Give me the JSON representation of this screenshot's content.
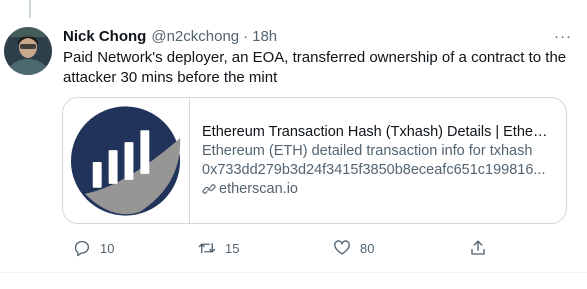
{
  "tweet": {
    "author_name": "Nick Chong",
    "handle": "@n2ckchong",
    "separator": "·",
    "time": "18h",
    "more_label": "···",
    "text": "Paid Network's deployer, an EOA, transferred ownership of a contract to the attacker 30 mins before the mint"
  },
  "card": {
    "title": "Ethereum Transaction Hash (Txhash) Details | Ethers...",
    "description": "Ethereum (ETH) detailed transaction info for txhash",
    "hash": "0x733dd279b3d24f3415f3850b8eceafc651c199816...",
    "domain": "etherscan.io",
    "thumbnail_icon": "etherscan-logo",
    "thumbnail_colors": {
      "navy": "#21325b",
      "gray": "#979695"
    }
  },
  "actions": {
    "reply_count": "10",
    "retweet_count": "15",
    "like_count": "80"
  },
  "colors": {
    "text": "#0f1419",
    "secondary": "#536471",
    "border": "#cfd9de"
  }
}
